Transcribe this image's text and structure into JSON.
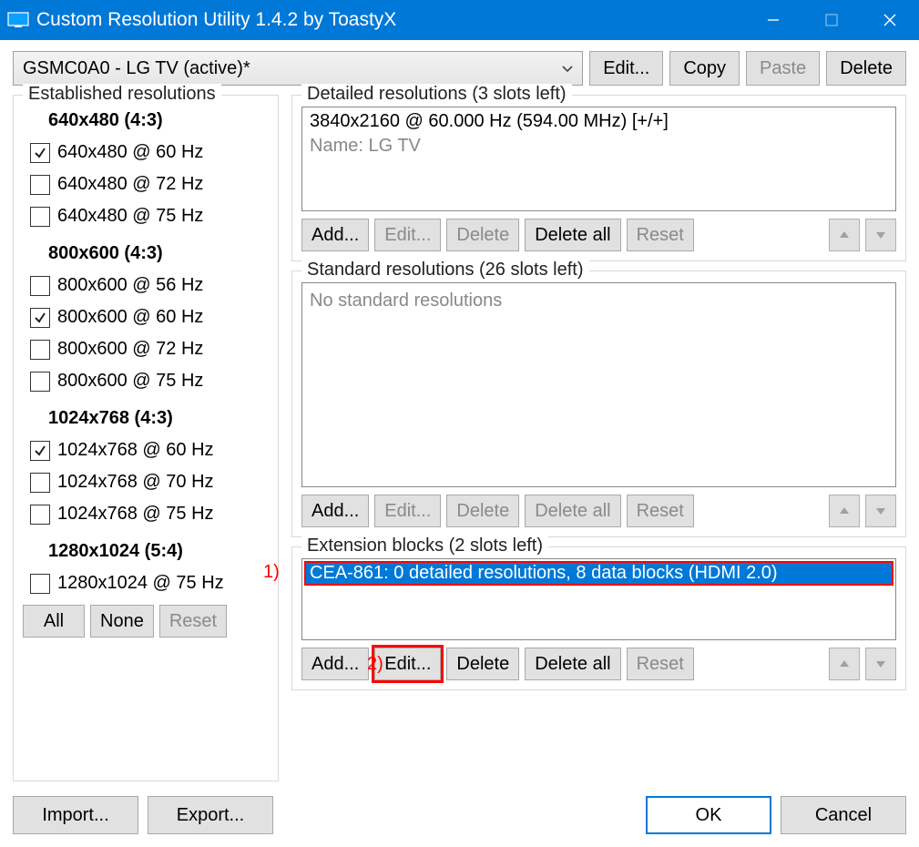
{
  "title": "Custom Resolution Utility 1.4.2 by ToastyX",
  "combo": "GSMC0A0 - LG TV (active)*",
  "topButtons": {
    "edit": "Edit...",
    "copy": "Copy",
    "paste": "Paste",
    "delete": "Delete"
  },
  "groups": {
    "established": "Established resolutions",
    "detailed": "Detailed resolutions (3 slots left)",
    "standard": "Standard resolutions (26 slots left)",
    "extension": "Extension blocks (2 slots left)"
  },
  "est": {
    "h0": "640x480 (4:3)",
    "i0": "640x480 @ 60 Hz",
    "i1": "640x480 @ 72 Hz",
    "i2": "640x480 @ 75 Hz",
    "h1": "800x600 (4:3)",
    "i3": "800x600 @ 56 Hz",
    "i4": "800x600 @ 60 Hz",
    "i5": "800x600 @ 72 Hz",
    "i6": "800x600 @ 75 Hz",
    "h2": "1024x768 (4:3)",
    "i7": "1024x768 @ 60 Hz",
    "i8": "1024x768 @ 70 Hz",
    "i9": "1024x768 @ 75 Hz",
    "h3": "1280x1024 (5:4)",
    "i10": "1280x1024 @ 75 Hz"
  },
  "detailed": {
    "line0": "3840x2160 @ 60.000 Hz (594.00 MHz) [+/+]",
    "line1": "Name: LG TV"
  },
  "standardPlaceholder": "No standard resolutions",
  "ext": {
    "line0": "CEA-861: 0 detailed resolutions, 8 data blocks (HDMI 2.0)"
  },
  "buttons": {
    "add": "Add...",
    "edit": "Edit...",
    "delete": "Delete",
    "deleteAll": "Delete all",
    "reset": "Reset",
    "all": "All",
    "none": "None",
    "import": "Import...",
    "export": "Export...",
    "ok": "OK",
    "cancel": "Cancel"
  },
  "annot": {
    "one": "1)",
    "two": "2)"
  }
}
